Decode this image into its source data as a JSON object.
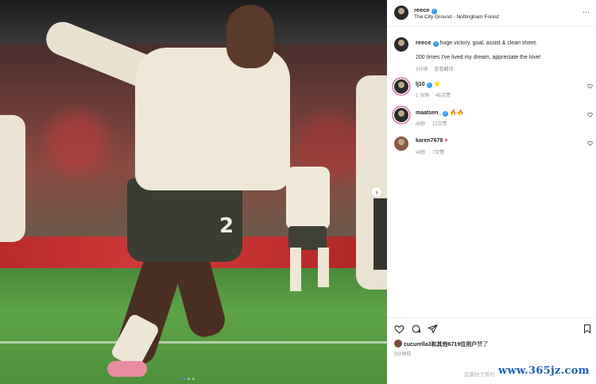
{
  "post": {
    "username": "reece",
    "location": "The City Ground - Nottingham Forest",
    "more": "···",
    "photo_number": "2"
  },
  "caption": {
    "username": "reece",
    "text": "huge victory. goal, assist & clean sheet.",
    "line2": "200 times I’ve lived my dream, appreciate the love!",
    "time": "3分钟",
    "translate": "查看翻译"
  },
  "comments": [
    {
      "username": "lj10",
      "emoji": "🌟",
      "time": "1 分钟",
      "likes": "48次赞"
    },
    {
      "username": "maatsen_",
      "emoji": "🔥🔥",
      "time": "45秒",
      "likes": "12次赞"
    },
    {
      "username": "karen7678",
      "emoji": "♥",
      "time": "48秒",
      "likes": "7次赞"
    }
  ],
  "likes": {
    "user": "cucurella3",
    "rest": "和其他6719位用户",
    "suffix": "赞了"
  },
  "posted_ago": "3分钟前",
  "watermark": "这篇帖子暂时",
  "brand": "www.365jz.com",
  "colors": {
    "accent": "#3897f0",
    "heart_red": "#ed4956",
    "brand": "#1d5fb0"
  }
}
